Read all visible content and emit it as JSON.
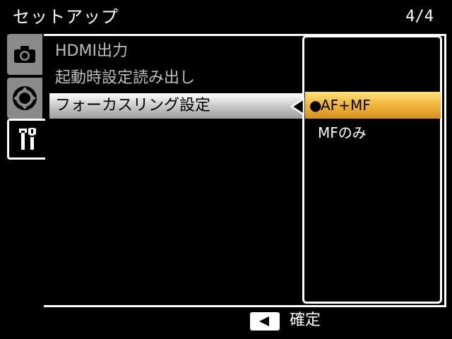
{
  "header": {
    "title": "セットアップ",
    "page": "4/4"
  },
  "tabs": [
    {
      "icon": "camera-icon",
      "active": false
    },
    {
      "icon": "dpad-icon",
      "active": false
    },
    {
      "icon": "setup-wrench-icon",
      "active": true
    }
  ],
  "menu": {
    "items": [
      {
        "label": "HDMI出力"
      },
      {
        "label": "起動時設定読み出し"
      },
      {
        "label": "フォーカスリング設定",
        "selected": true
      }
    ]
  },
  "submenu": {
    "options": [
      {
        "label": "AF+MF",
        "selected": true,
        "bullet": "●"
      },
      {
        "label": "MFのみ",
        "selected": false
      }
    ]
  },
  "footer": {
    "confirm_label": "確定"
  },
  "colors": {
    "highlight": "#f0b43a",
    "tab_inactive": "#8a8a8a"
  }
}
